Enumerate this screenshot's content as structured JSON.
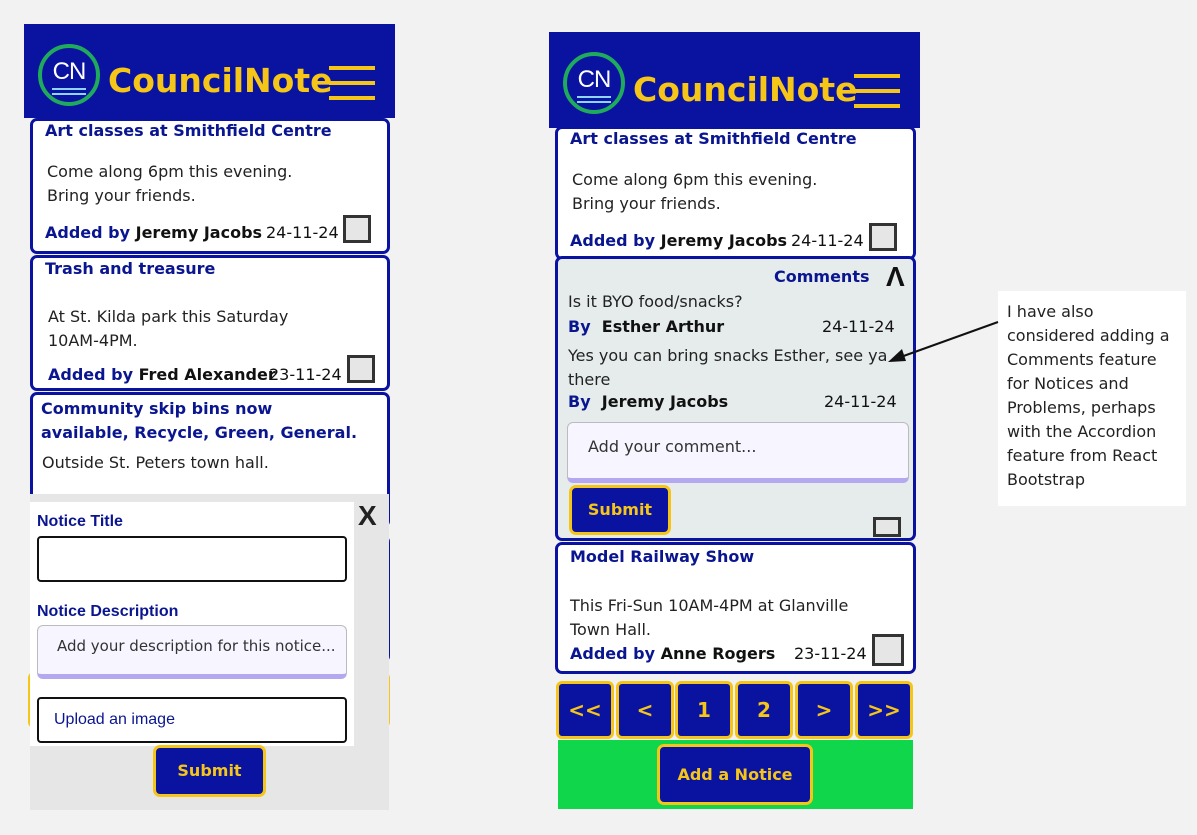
{
  "app": {
    "logo_text": "CN",
    "brand": "CouncilNote"
  },
  "left": {
    "notices": [
      {
        "title": "Art classes at Smithfield Centre",
        "body_line1": "Come along 6pm this evening.",
        "body_line2": "Bring your friends.",
        "added_label": "Added by ",
        "author": "Jeremy Jacobs",
        "date": "24-11-24"
      },
      {
        "title": "Trash and treasure",
        "body_line1": "At St. Kilda park this Saturday",
        "body_line2": "10AM-4PM.",
        "added_label": "Added by ",
        "author": "Fred Alexander",
        "date": "23-11-24"
      },
      {
        "title_line1": "Community skip bins now",
        "title_line2": "available, Recycle, Green, General.",
        "body_line1": "Outside St. Peters town hall."
      }
    ],
    "form": {
      "close": "X",
      "title_label": "Notice Title",
      "desc_label": "Notice Description",
      "desc_placeholder": "Add your description for this notice...",
      "upload_label": "Upload an image",
      "submit": "Submit"
    }
  },
  "right": {
    "notices": [
      {
        "title": "Art classes at Smithfield Centre",
        "body_line1": "Come along 6pm this evening.",
        "body_line2": "Bring your friends.",
        "added_label": "Added by ",
        "author": "Jeremy Jacobs",
        "date": "24-11-24"
      },
      {
        "title": "Model Railway Show",
        "body_line1": "This Fri-Sun 10AM-4PM at Glanville",
        "body_line2": "Town Hall.",
        "added_label": "Added by ",
        "author": "Anne Rogers",
        "date": "23-11-24"
      }
    ],
    "comments": {
      "header": "Comments",
      "collapse": "Λ",
      "items": [
        {
          "text_line1": "Is it BYO food/snacks?",
          "by_label": "By",
          "author": "Esther Arthur",
          "date": "24-11-24"
        },
        {
          "text_line1": "Yes you can bring snacks Esther, see ya",
          "text_line2": "there",
          "by_label": "By",
          "author": "Jeremy Jacobs",
          "date": "24-11-24"
        }
      ],
      "placeholder": "Add your comment...",
      "submit": "Submit"
    },
    "pagination": [
      "<<",
      "<",
      "1",
      "2",
      ">",
      ">>"
    ],
    "add_notice": "Add a Notice"
  },
  "note": {
    "lines": [
      "I have also",
      "considered adding a",
      "Comments feature",
      "for Notices and",
      "Problems, perhaps",
      "with the Accordion",
      "feature from React",
      "Bootstrap"
    ]
  },
  "colors": {
    "navy": "#0a13a0",
    "yellow": "#f5c518",
    "green": "#0fd64a"
  }
}
